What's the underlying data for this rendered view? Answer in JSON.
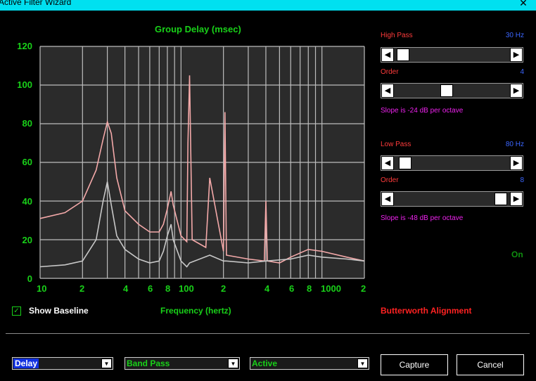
{
  "window": {
    "title": "Active Filter Wizard",
    "close_glyph": "✕"
  },
  "graph": {
    "title": "Group Delay (msec)",
    "y_ticks": [
      "120",
      "100",
      "80",
      "60",
      "40",
      "20",
      "0"
    ],
    "x_ticks": [
      "10",
      "2",
      "4",
      "6",
      "8",
      "100",
      "2",
      "4",
      "6",
      "8",
      "1000",
      "2"
    ],
    "x_label": "Frequency (hertz)",
    "colors": {
      "plot_bg": "#2b2b2b",
      "grid": "#bdbdbd",
      "with_filter": "#f4a9a9",
      "baseline": "#c8c8c8"
    }
  },
  "chart_data": {
    "type": "line",
    "title": "Group Delay (msec)",
    "xlabel": "Frequency (hertz)",
    "ylabel": "",
    "x_scale": "log",
    "xlim": [
      10,
      2000
    ],
    "ylim": [
      0,
      120
    ],
    "series": [
      {
        "key": "with_filter",
        "x": [
          10,
          15,
          20,
          25,
          28,
          30,
          32,
          35,
          40,
          50,
          60,
          70,
          75,
          80,
          85,
          88,
          100,
          110,
          112,
          115,
          120,
          150,
          160,
          200,
          205,
          210,
          300,
          390,
          400,
          410,
          500,
          600,
          800,
          1000,
          1500,
          2000
        ],
        "y": [
          31,
          34,
          40,
          56,
          72,
          81,
          75,
          52,
          35,
          28,
          24,
          24,
          28,
          36,
          45,
          38,
          22,
          19,
          70,
          105,
          20,
          16,
          52,
          14,
          86,
          12,
          10,
          9,
          40,
          9,
          8,
          11,
          15,
          14,
          11,
          9
        ]
      },
      {
        "key": "baseline",
        "x": [
          10,
          15,
          20,
          25,
          28,
          30,
          32,
          35,
          40,
          50,
          60,
          70,
          75,
          80,
          85,
          88,
          100,
          110,
          115,
          160,
          200,
          210,
          300,
          400,
          600,
          800,
          1000,
          1500,
          2000
        ],
        "y": [
          6,
          7,
          9,
          20,
          40,
          50,
          38,
          22,
          15,
          10,
          8,
          9,
          14,
          22,
          28,
          20,
          9,
          6,
          8,
          12,
          9,
          9,
          8,
          9,
          10,
          12,
          11,
          10,
          9
        ]
      }
    ]
  },
  "options": {
    "show_baseline_label": "Show Baseline",
    "show_baseline_checked": true,
    "check_glyph": "✓",
    "alignment": "Butterworth Alignment"
  },
  "high_pass": {
    "label": "High Pass",
    "value": "30 Hz",
    "position": 0.03
  },
  "high_pass_order": {
    "label": "Order",
    "value": "4",
    "position": 0.45,
    "slope": "Slope is -24 dB per octave"
  },
  "low_pass": {
    "label": "Low Pass",
    "value": "80 Hz",
    "position": 0.05
  },
  "low_pass_order": {
    "label": "Order",
    "value": "8",
    "position": 0.97,
    "slope": "Slope is -48 dB per octave"
  },
  "status": {
    "text": "On"
  },
  "bottom": {
    "view_combo": "Delay",
    "type_combo": "Band Pass",
    "mode_combo": "Active",
    "combo_arrow": "▼",
    "capture_label": "Capture",
    "cancel_label": "Cancel"
  },
  "arrows": {
    "left": "◀",
    "right": "▶"
  }
}
